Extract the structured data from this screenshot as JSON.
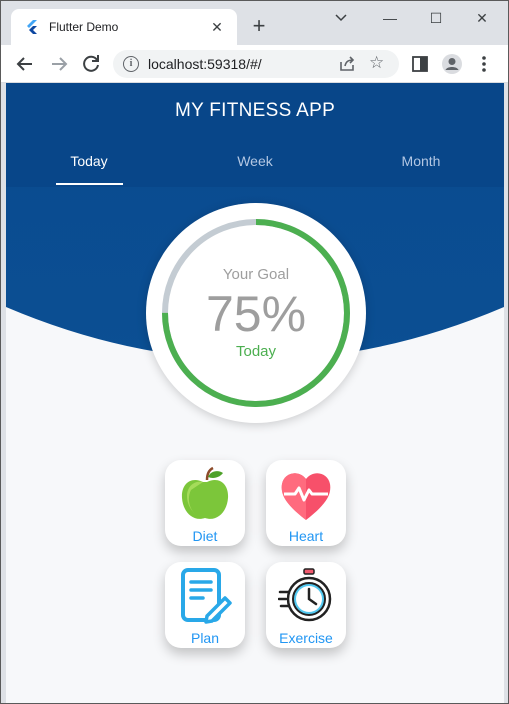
{
  "browser": {
    "tab_title": "Flutter Demo",
    "tab_close": "✕",
    "new_tab": "+",
    "url": "localhost:59318/#/",
    "window_controls": {
      "minimize": "—",
      "maximize": "☐",
      "close": "✕"
    },
    "icons": [
      "back-arrow-icon",
      "forward-arrow-icon",
      "reload-icon",
      "info-icon",
      "share-icon",
      "star-icon",
      "side-panel-icon",
      "profile-icon",
      "menu-icon"
    ]
  },
  "app": {
    "title": "MY FITNESS APP",
    "tabs": [
      {
        "label": "Today",
        "active": true
      },
      {
        "label": "Week",
        "active": false
      },
      {
        "label": "Month",
        "active": false
      }
    ],
    "goal": {
      "label": "Your Goal",
      "percent_text": "75%",
      "progress": 0.75,
      "period": "Today"
    },
    "actions": [
      {
        "label": "Diet",
        "icon": "apple-icon"
      },
      {
        "label": "Heart",
        "icon": "heart-icon"
      },
      {
        "label": "Plan",
        "icon": "plan-icon"
      },
      {
        "label": "Exercise",
        "icon": "stopwatch-icon"
      }
    ],
    "colors": {
      "primary": "#0a4a8f",
      "progress": "#4caf50",
      "track": "#c4ccd3",
      "label": "#2196f3"
    }
  }
}
